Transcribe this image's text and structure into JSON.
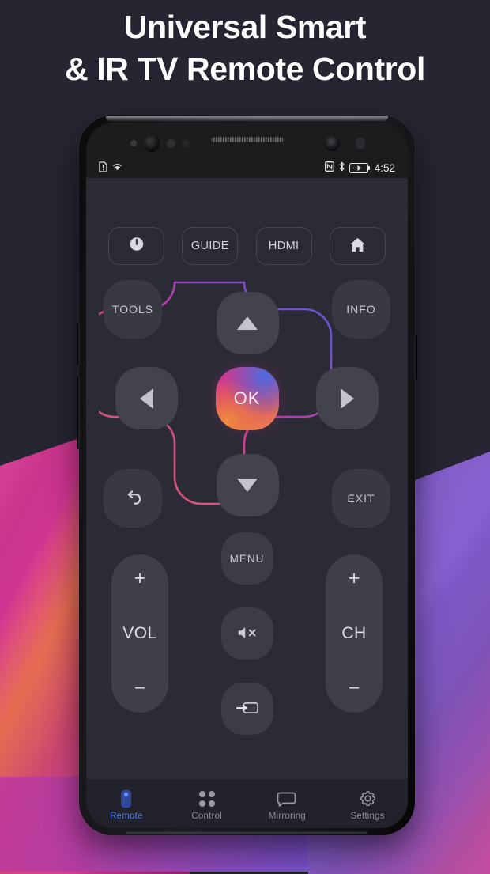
{
  "promo": {
    "title_line1": "Universal Smart",
    "title_line2": "& IR TV Remote Control",
    "accent_blue": "#4a7df0",
    "accent_pink": "#d8397e",
    "accent_orange": "#ef8f46",
    "screen_bg": "#2b2b36",
    "button_bg": "#3c3c46"
  },
  "status_bar": {
    "sim_icon": "sim-card-alert-icon",
    "wifi_icon": "wifi-icon",
    "nfc_icon": "nfc-icon",
    "bluetooth_icon": "bluetooth-icon",
    "battery_icon": "battery-charging-icon",
    "time": "4:52"
  },
  "top_row": [
    {
      "label": "",
      "icon": "power-icon",
      "name": "power-button"
    },
    {
      "label": "GUIDE",
      "icon": "",
      "name": "guide-button"
    },
    {
      "label": "HDMI",
      "icon": "",
      "name": "hdmi-button"
    },
    {
      "label": "",
      "icon": "home-icon",
      "name": "home-button"
    }
  ],
  "dpad": {
    "tools_label": "TOOLS",
    "info_label": "INFO",
    "exit_label": "EXIT",
    "back_icon": "back-arrow-icon",
    "up_icon": "arrow-up-icon",
    "down_icon": "arrow-down-icon",
    "left_icon": "arrow-left-icon",
    "right_icon": "arrow-right-icon",
    "ok_label": "OK"
  },
  "controls": {
    "volume": {
      "plus": "+",
      "label": "VOL",
      "minus": "−"
    },
    "channel": {
      "plus": "+",
      "label": "CH",
      "minus": "−"
    },
    "menu_label": "MENU",
    "mute_icon": "volume-mute-icon",
    "source_icon": "input-source-icon"
  },
  "bottom_nav": [
    {
      "label": "Remote",
      "icon": "remote-icon",
      "active": true
    },
    {
      "label": "Control",
      "icon": "grid-dots-icon",
      "active": false
    },
    {
      "label": "Mirroring",
      "icon": "screen-mirroring-icon",
      "active": false
    },
    {
      "label": "Settings",
      "icon": "gear-icon",
      "active": false
    }
  ]
}
